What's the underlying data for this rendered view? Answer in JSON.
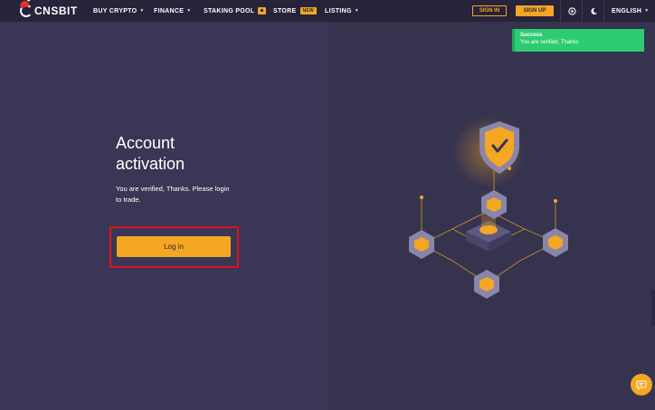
{
  "header": {
    "logo_text": "CNSBIT",
    "nav": [
      {
        "label": "BUY CRYPTO",
        "has_caret": true
      },
      {
        "label": "FINANCE",
        "has_caret": true
      },
      {
        "label": "STAKING POOL",
        "badge": "lock-icon"
      },
      {
        "label": "STORE",
        "badge_text": "NEW"
      },
      {
        "label": "LISTING",
        "has_caret": true
      }
    ],
    "signin_label": "SIGN IN",
    "signup_label": "SIGN UP",
    "language_label": "ENGLISH",
    "icons": [
      "globe-icon",
      "moon-icon"
    ]
  },
  "main": {
    "heading_line1": "Account",
    "heading_line2": "activation",
    "description_line1": "You are verified, Thanks. Please login",
    "description_line2": "to trade.",
    "login_button": "Log in"
  },
  "toast": {
    "title": "Success",
    "message": "You are verified, Thanks"
  },
  "colors": {
    "accent": "#f5a623",
    "nav_bg": "#26233a",
    "page_bg": "#3a3656",
    "success": "#2ecc71",
    "highlight": "#d8141c"
  },
  "chat_icon": "chat-bubble-icon"
}
